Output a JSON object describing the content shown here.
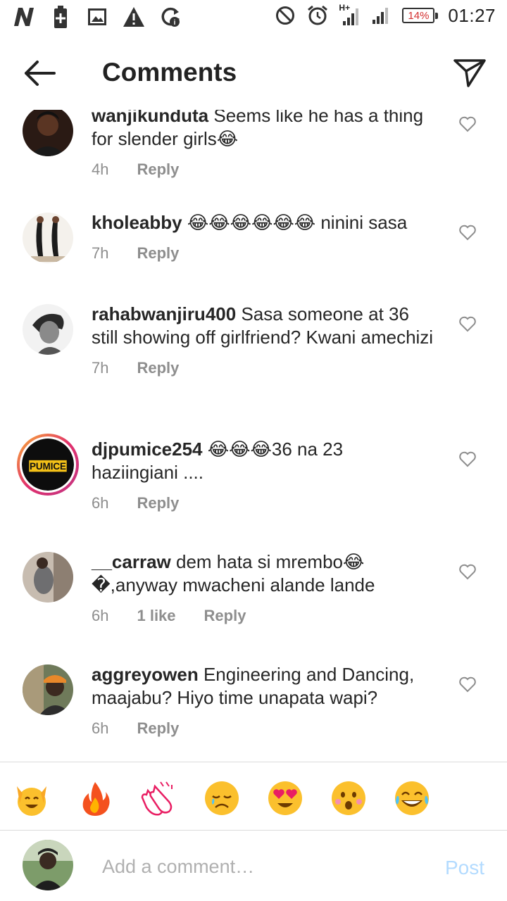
{
  "status_bar": {
    "battery": "14%",
    "time": "01:27",
    "network": "H+",
    "icons": [
      "n-app-icon",
      "battery-plus-icon",
      "image-icon",
      "warning-icon",
      "sync-icon",
      "do-not-disturb-icon",
      "alarm-icon",
      "signal-icon",
      "signal-icon"
    ]
  },
  "header": {
    "title": "Comments",
    "back_icon": "arrow-left-icon",
    "share_icon": "send-icon"
  },
  "comments": [
    {
      "username": "wanjikunduta",
      "text": "Seems like he has a thing for slender girls😂",
      "time": "4h",
      "likes": "",
      "reply": "Reply"
    },
    {
      "username": "kholeabby",
      "text": "😂😂😂😂😂😂 ninini sasa",
      "time": "7h",
      "likes": "",
      "reply": "Reply"
    },
    {
      "username": "rahabwanjiru400",
      "text": "Sasa someone at 36 still showing off girlfriend? Kwani amechizi",
      "time": "7h",
      "likes": "",
      "reply": "Reply"
    },
    {
      "username": "djpumice254",
      "text": "😂😂😂36 na 23 haziingiani ....",
      "time": "6h",
      "likes": "",
      "reply": "Reply"
    },
    {
      "username": "__carraw",
      "text": "dem hata si mrembo😂 �,anyway mwacheni alande lande",
      "time": "6h",
      "likes": "1 like",
      "reply": "Reply"
    },
    {
      "username": "aggreyowen",
      "text": "Engineering and Dancing, maajabu? Hiyo time unapata wapi?",
      "time": "6h",
      "likes": "",
      "reply": "Reply"
    }
  ],
  "reactions": [
    "raised-hands-emoji",
    "fire-emoji",
    "clapping-hands-emoji",
    "sad-face-emoji",
    "heart-eyes-emoji",
    "surprised-face-emoji",
    "tears-of-joy-emoji"
  ],
  "composer": {
    "placeholder": "Add a comment…",
    "post_label": "Post"
  },
  "colors": {
    "text": "#262626",
    "meta": "#8e8e8e",
    "post_disabled": "#b3dbff",
    "battery_low": "#d32f2f",
    "emoji_yellow": "#fbc02d"
  }
}
